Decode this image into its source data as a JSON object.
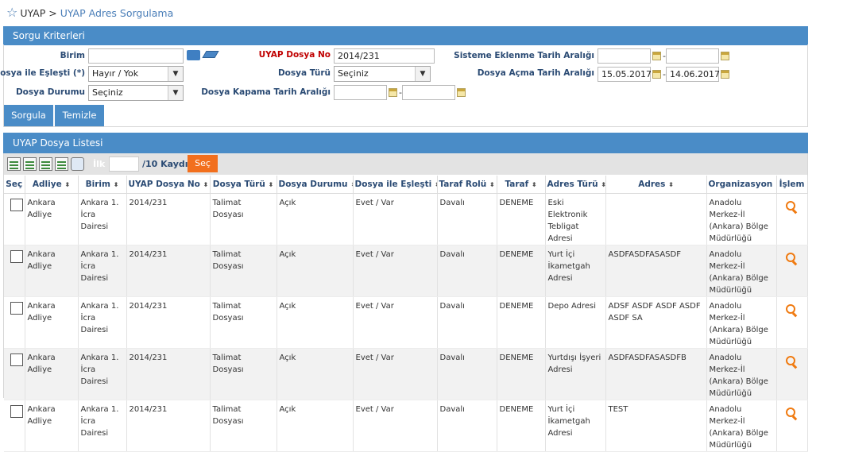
{
  "breadcrumb": {
    "root": "UYAP",
    "separator": ">",
    "current": "UYAP Adres Sorgulama"
  },
  "criteria": {
    "title": "Sorgu Kriterleri",
    "birim_label": "Birim",
    "birim_value": "",
    "dosya_no_label": "UYAP Dosya No",
    "dosya_no_value": "2014/231",
    "sistem_tarih_label": "Sisteme Eklenme Tarih Aralığı",
    "sistem_tarih_start": "",
    "sistem_tarih_end": "",
    "eslesti_label": "Dosya ile Eşleşti (*)",
    "eslesti_value": "Hayır / Yok",
    "dosya_turu_label": "Dosya Türü",
    "dosya_turu_value": "Seçiniz",
    "acma_tarih_label": "Dosya Açma Tarih Aralığı",
    "acma_tarih_start": "15.05.2017",
    "acma_tarih_end": "14.06.2017",
    "durum_label": "Dosya Durumu",
    "durum_value": "Seçiniz",
    "kapama_tarih_label": "Dosya Kapama Tarih Aralığı",
    "kapama_tarih_start": "",
    "kapama_tarih_end": "",
    "range_sep": "-",
    "sorgula": "Sorgula",
    "temizle": "Temizle"
  },
  "list": {
    "title": "UYAP Dosya Listesi",
    "ilk_label": "İlk",
    "ilk_value": "",
    "kayit_label": "/10 Kaydı",
    "sec_button": "Seç",
    "columns": [
      "Seç",
      "Adliye",
      "Birim",
      "UYAP Dosya No",
      "Dosya Türü",
      "Dosya Durumu",
      "Dosya ile Eşleşti",
      "Taraf Rolü",
      "Taraf",
      "Adres Türü",
      "Adres",
      "Organizasyon",
      "İşlem"
    ],
    "sort_glyph": "⬍",
    "rows": [
      {
        "adliye": "Ankara Adliye",
        "birim": "Ankara 1. İcra Dairesi",
        "dosya_no": "2014/231",
        "tur": "Talimat Dosyası",
        "durum": "Açık",
        "eslesti": "Evet / Var",
        "rol": "Davalı",
        "taraf": "DENEME",
        "adres_turu": "Eski Elektronik Tebligat Adresi",
        "adres": "",
        "org": "Anadolu Merkez-İl (Ankara) Bölge Müdürlüğü"
      },
      {
        "adliye": "Ankara Adliye",
        "birim": "Ankara 1. İcra Dairesi",
        "dosya_no": "2014/231",
        "tur": "Talimat Dosyası",
        "durum": "Açık",
        "eslesti": "Evet / Var",
        "rol": "Davalı",
        "taraf": "DENEME",
        "adres_turu": "Yurt İçi İkametgah Adresi",
        "adres": "ASDFASDFASASDF",
        "org": "Anadolu Merkez-İl (Ankara) Bölge Müdürlüğü"
      },
      {
        "adliye": "Ankara Adliye",
        "birim": "Ankara 1. İcra Dairesi",
        "dosya_no": "2014/231",
        "tur": "Talimat Dosyası",
        "durum": "Açık",
        "eslesti": "Evet / Var",
        "rol": "Davalı",
        "taraf": "DENEME",
        "adres_turu": "Depo Adresi",
        "adres": "ADSF ASDF ASDF ASDF ASDF SA",
        "org": "Anadolu Merkez-İl (Ankara) Bölge Müdürlüğü"
      },
      {
        "adliye": "Ankara Adliye",
        "birim": "Ankara 1. İcra Dairesi",
        "dosya_no": "2014/231",
        "tur": "Talimat Dosyası",
        "durum": "Açık",
        "eslesti": "Evet / Var",
        "rol": "Davalı",
        "taraf": "DENEME",
        "adres_turu": "Yurtdışı İşyeri Adresi",
        "adres": "ASDFASDFASASDFB",
        "org": "Anadolu Merkez-İl (Ankara) Bölge Müdürlüğü"
      },
      {
        "adliye": "Ankara Adliye",
        "birim": "Ankara 1. İcra Dairesi",
        "dosya_no": "2014/231",
        "tur": "Talimat Dosyası",
        "durum": "Açık",
        "eslesti": "Evet / Var",
        "rol": "Davalı",
        "taraf": "DENEME",
        "adres_turu": "Yurt İçi İkametgah Adresi",
        "adres": "TEST",
        "org": "Anadolu Merkez-İl (Ankara) Bölge Müdürlüğü"
      }
    ]
  },
  "colors": {
    "header_blue": "#4a8cc7",
    "accent_orange": "#f26f1d",
    "label_navy": "#2b4b74",
    "label_red": "#c00000"
  }
}
